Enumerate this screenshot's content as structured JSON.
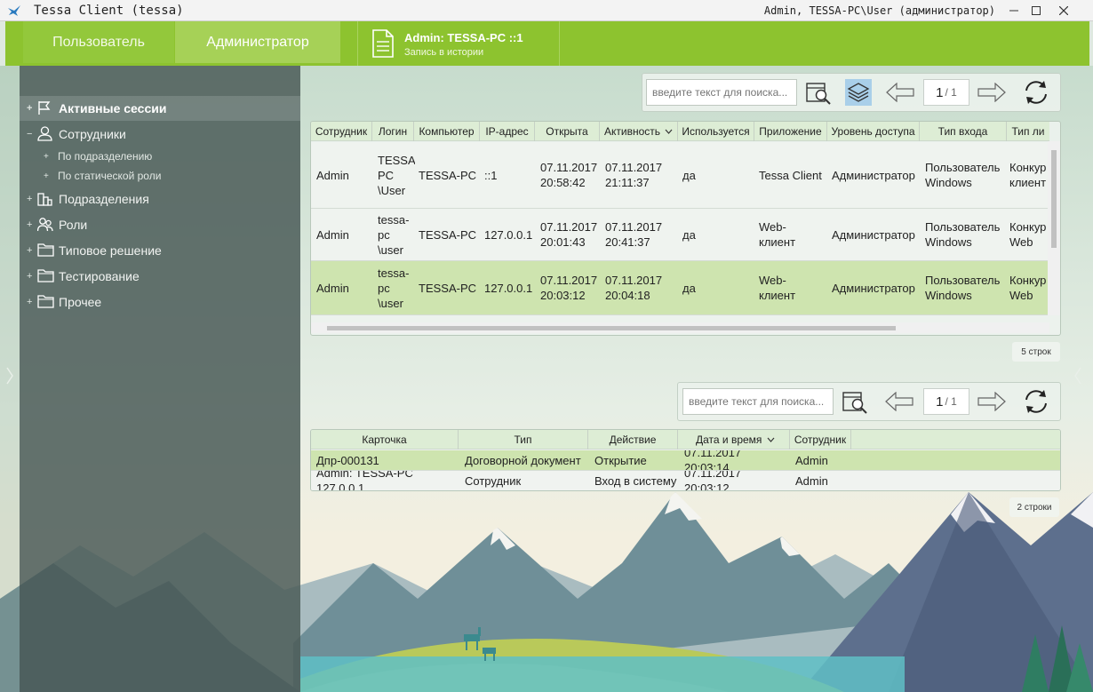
{
  "window": {
    "title": "Tessa Client (tessa)",
    "user": "Admin, TESSA-PC\\User (администратор)",
    "accent": "#8dc32f"
  },
  "topbar": {
    "tab_user": "Пользователь",
    "tab_admin": "Администратор",
    "doc_title": "Admin: TESSA-PC ::1",
    "doc_subtitle": "Запись в истории"
  },
  "nav": {
    "items": [
      {
        "label": "Активные сессии",
        "expander": "+",
        "icon": "flag-icon"
      },
      {
        "label": "Сотрудники",
        "expander": "−",
        "icon": "person-icon"
      },
      {
        "label": "По подразделению",
        "expander": "+"
      },
      {
        "label": "По статической роли",
        "expander": "+"
      },
      {
        "label": "Подразделения",
        "expander": "+",
        "icon": "building-icon"
      },
      {
        "label": "Роли",
        "expander": "+",
        "icon": "people-icon"
      },
      {
        "label": "Типовое решение",
        "expander": "+",
        "icon": "folder-icon"
      },
      {
        "label": "Тестирование",
        "expander": "+",
        "icon": "folder-icon"
      },
      {
        "label": "Прочее",
        "expander": "+",
        "icon": "folder-icon"
      }
    ]
  },
  "sessions": {
    "search_placeholder": "введите текст для поиска...",
    "page": "1",
    "pages": "/ 1",
    "columns": [
      "Сотрудник",
      "Логин",
      "Компьютер",
      "IP-адрес",
      "Открыта",
      "Активность",
      "Используется",
      "Приложение",
      "Уровень доступа",
      "Тип входа",
      "Тип ли"
    ],
    "sort_column": "Активность",
    "rows": [
      [
        "Admin",
        "TESSA-\nPC\n\\User",
        "TESSA-PC",
        "::1",
        "07.11.2017\n20:58:42",
        "07.11.2017\n21:11:37",
        "да",
        "Tessa Client",
        "Администратор",
        "Пользователь\nWindows",
        "Конкур\nклиент"
      ],
      [
        "Admin",
        "tessa-\npc\n\\user",
        "TESSA-PC",
        "127.0.0.1",
        "07.11.2017\n20:01:43",
        "07.11.2017\n20:41:37",
        "да",
        "Web-\nклиент",
        "Администратор",
        "Пользователь\nWindows",
        "Конкур\nWeb"
      ],
      [
        "Admin",
        "tessa-\npc\n\\user",
        "TESSA-PC",
        "127.0.0.1",
        "07.11.2017\n20:03:12",
        "07.11.2017\n20:04:18",
        "да",
        "Web-\nклиент",
        "Администратор",
        "Пользователь\nWindows",
        "Конкур\nWeb"
      ]
    ],
    "selected_row": 2,
    "row_count": "5 строк"
  },
  "history": {
    "search_placeholder": "введите текст для поиска...",
    "page": "1",
    "pages": "/ 1",
    "columns": [
      "Карточка",
      "Тип",
      "Действие",
      "Дата и время",
      "Сотрудник"
    ],
    "sort_column": "Дата и время",
    "rows": [
      [
        "Дпр-000131",
        "Договорной документ",
        "Открытие",
        "07.11.2017 20:03:14",
        "Admin"
      ],
      [
        "Admin: TESSA-PC 127.0.0.1",
        "Сотрудник",
        "Вход в систему",
        "07.11.2017 20:03:12",
        "Admin"
      ]
    ],
    "selected_row": 0,
    "row_count": "2 строки"
  }
}
